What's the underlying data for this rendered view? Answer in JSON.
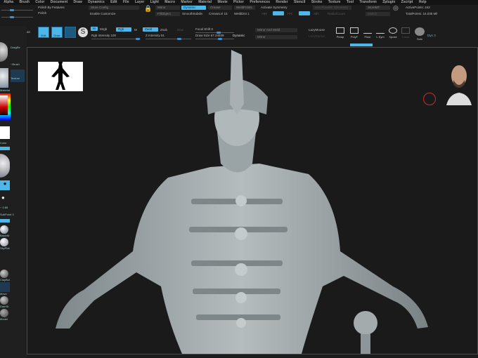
{
  "menu": [
    "Alpha",
    "Brush",
    "Color",
    "Document",
    "Draw",
    "Dynamics",
    "Edit",
    "File",
    "Layer",
    "Light",
    "Macro",
    "Marker",
    "Material",
    "Movie",
    "Picker",
    "Preferences",
    "Render",
    "Stencil",
    "Stroke",
    "Texture",
    "Tool",
    "Transform",
    "Zplugin",
    "Zscript",
    "Help"
  ],
  "top": {
    "polish_features": "Polish By Features",
    "polish": "Polish",
    "store_config": "Store Config",
    "enable_customize": "Enable Customize",
    "mirror": "Mirror",
    "dynamic": "Dynamic",
    "crease": "Crease",
    "fill_object": "FillObject",
    "smooth_subdiv": "SmoothSubdiv",
    "crease_lvl": "CreaseLvl 15",
    "weld_points": "WeldPoints",
    "activate_symmetry": "Activate Symmetry",
    "weld_dist": "WeldDist 1",
    "use_posable_symmetry": "Use Posable Symmetry",
    "store_mt": "StoreMT",
    "switch": "Switch",
    "active_points": "ActivePoints: 242",
    "total_points": "TotalPoints: 15.035 Mil",
    "x": ">X<",
    "y": ">Y<",
    "z": ">Z<",
    "radial_count": "RadialCount"
  },
  "toolbar": {
    "live_boolean": "Live Boolean",
    "edit": "Edit",
    "draw": "Draw",
    "m": "M",
    "mrgb": "Mrgb",
    "rgb": "Rgb",
    "rgb_m": "M",
    "zadd": "Zadd",
    "zsub": "Zsub",
    "zcut": "Zcut",
    "rgb_intensity": "Rgb Intensity 100",
    "z_intensity": "Z Intensity 51",
    "focal_shift": "Focal Shift 0",
    "draw_size": "Draw Size 67.24939",
    "dynamic": "Dynamic",
    "mirror_weld": "Mirror And Weld",
    "mirror": "Mirror",
    "lazymouse": "LazyMouse",
    "lazyradius": "LazyRadius",
    "persp": "Persp",
    "polyf": "PolyF",
    "floor": "Floor",
    "lsym": "L.Sym",
    "xpose": "Xpose",
    "local": "Local",
    "solo": "Solo",
    "dyn": "Dyn 3"
  },
  "tray": {
    "dragrect": "DragRe",
    "brush": "~Brush",
    "texture": "Texture",
    "material": "Material",
    "color": "Color",
    "focal": "~ 0.85",
    "subpoint": "SubPoint 3",
    "basic": "BasicM",
    "skinshade": "SkyPlat",
    "claybuild": "ClayBui",
    "move": "Move",
    "dam": "DamSt",
    "model": "Model"
  },
  "colors": {
    "accent": "#4fb6e8",
    "bg": "#1c1c1c",
    "model": "#9aa3a6"
  }
}
